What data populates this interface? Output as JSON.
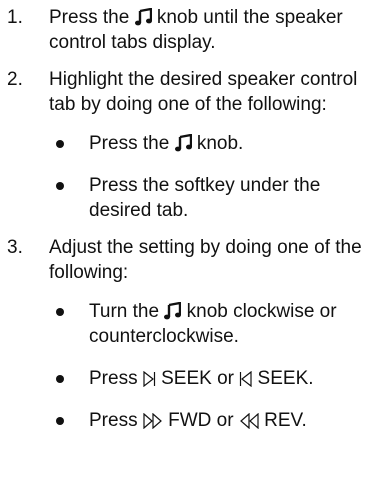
{
  "steps": [
    {
      "num": "1.",
      "text": [
        "Press the ",
        {
          "icon": "music-note-icon"
        },
        " knob until the speaker control tabs display."
      ]
    },
    {
      "num": "2.",
      "text": [
        "Highlight the desired speaker control tab by doing one of the following:"
      ],
      "options": [
        [
          "Press the ",
          {
            "icon": "music-note-icon"
          },
          " knob."
        ],
        [
          "Press the softkey under the desired tab."
        ]
      ]
    },
    {
      "num": "3.",
      "text": [
        "Adjust the setting by doing one of the following:"
      ],
      "options": [
        [
          "Turn the ",
          {
            "icon": "music-note-icon"
          },
          " knob clockwise or counterclockwise."
        ],
        [
          "Press ",
          {
            "icon": "seek-forward-icon"
          },
          " SEEK or ",
          {
            "icon": "seek-back-icon"
          },
          " SEEK."
        ],
        [
          "Press ",
          {
            "icon": "fast-forward-icon"
          },
          " FWD or ",
          {
            "icon": "rewind-icon"
          },
          " REV."
        ]
      ]
    }
  ]
}
